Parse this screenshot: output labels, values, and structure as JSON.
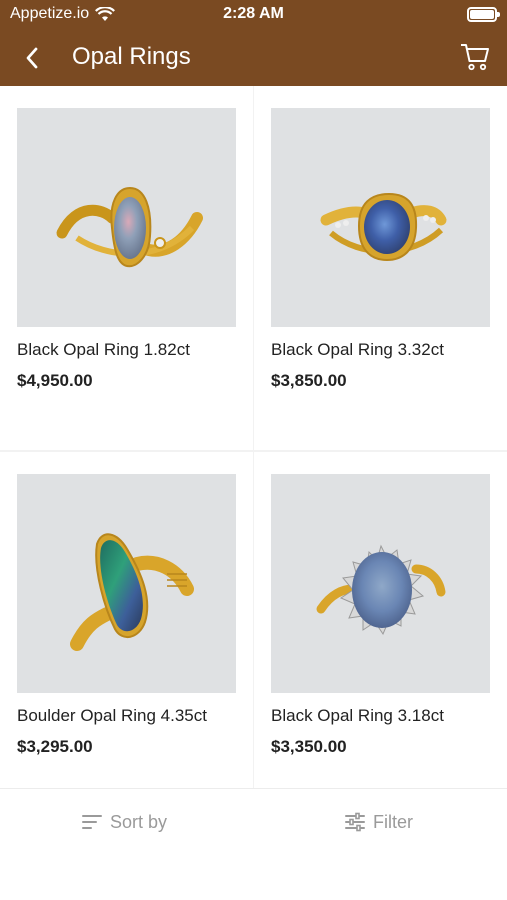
{
  "status_bar": {
    "carrier": "Appetize.io",
    "time": "2:28 AM"
  },
  "nav": {
    "title": "Opal Rings"
  },
  "products": [
    {
      "name": "Black Opal Ring 1.82ct",
      "price": "$4,950.00"
    },
    {
      "name": "Black Opal Ring 3.32ct",
      "price": "$3,850.00"
    },
    {
      "name": "Boulder Opal Ring 4.35ct",
      "price": "$3,295.00"
    },
    {
      "name": "Black Opal Ring 3.18ct",
      "price": "$3,350.00"
    }
  ],
  "bottom_bar": {
    "sort_label": "Sort by",
    "filter_label": "Filter"
  },
  "colors": {
    "header": "#7a4a22",
    "text": "#222222",
    "muted": "#9a9a9a"
  }
}
